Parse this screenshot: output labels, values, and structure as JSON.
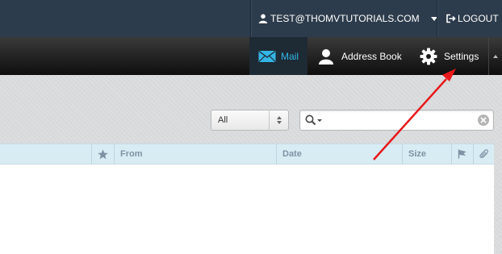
{
  "header": {
    "account_label": "TEST@THOMVTUTORIALS.COM",
    "logout_label": "LOGOUT"
  },
  "taskmenu": {
    "mail_label": "Mail",
    "address_book_label": "Address Book",
    "settings_label": "Settings"
  },
  "toolbar": {
    "filter_value": "All",
    "search_value": ""
  },
  "messagelist": {
    "columns": {
      "from": "From",
      "date": "Date",
      "size": "Size"
    }
  },
  "colors": {
    "header_bg": "#2d3c4c",
    "accent": "#33b5e5",
    "list_header_bg": "#d8ecf4",
    "annotation_arrow": "#e8191c"
  },
  "icons": [
    "user-icon",
    "dropdown-caret-icon",
    "logout-icon",
    "mail-icon",
    "address-book-icon",
    "settings-gear-icon",
    "collapse-icon",
    "search-icon",
    "reset-search-icon",
    "star-icon",
    "flag-icon",
    "attachment-icon"
  ]
}
